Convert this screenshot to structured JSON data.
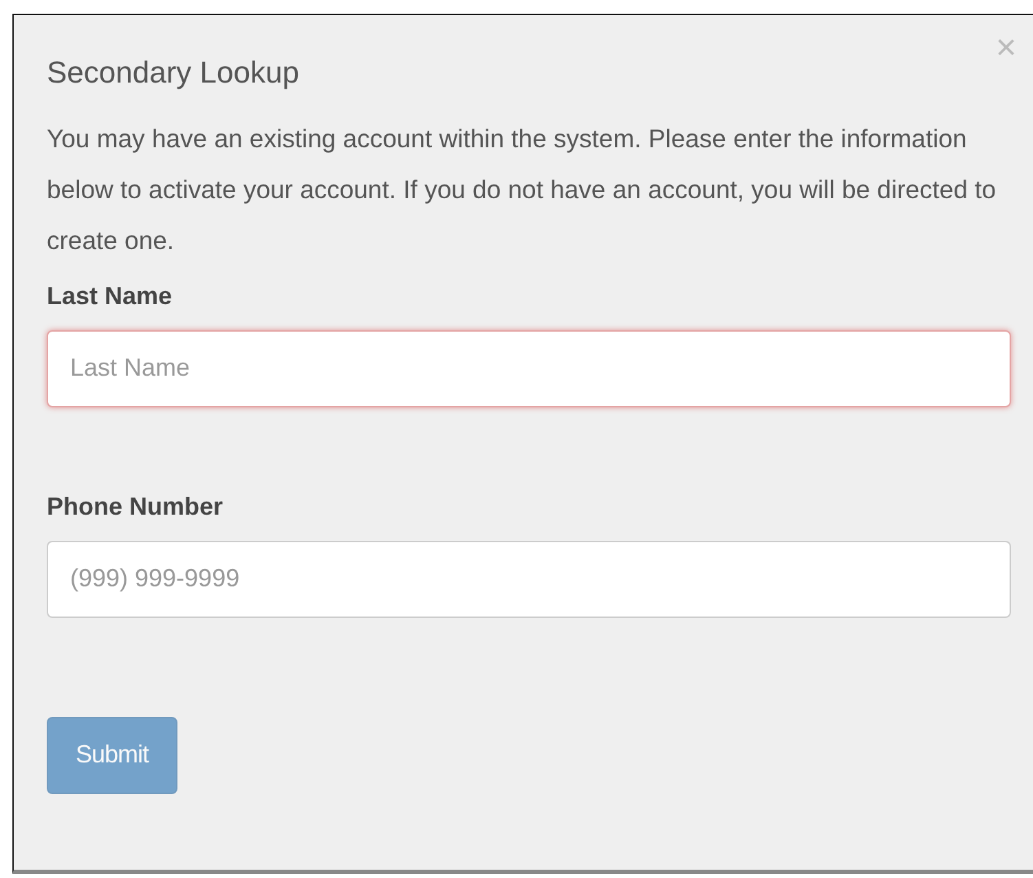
{
  "dialog": {
    "close": "×",
    "title": "Secondary Lookup",
    "message": "You may have an existing account within the system. Please enter the information below to activate your account. If you do not have an account, you will be directed to create one.",
    "fields": [
      {
        "label": "Last Name",
        "placeholder": "Last Name",
        "invalid": true
      },
      {
        "label": "Phone Number",
        "placeholder": "(999) 999-9999",
        "invalid": false
      }
    ],
    "submit": {
      "label": "Submit",
      "disabled": true
    }
  }
}
